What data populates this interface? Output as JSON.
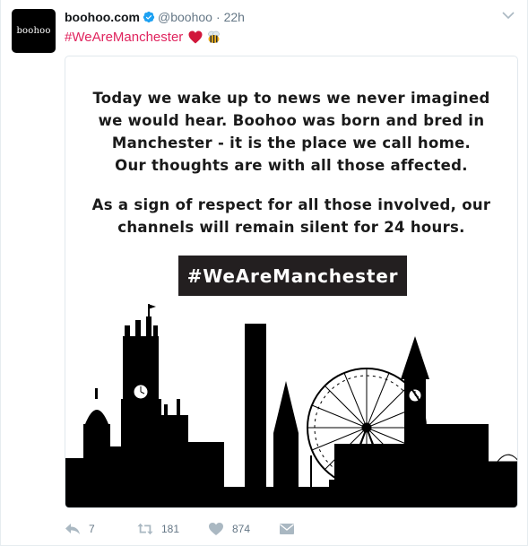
{
  "tweet": {
    "avatar_text": "boohoo",
    "display_name": "boohoo.com",
    "handle": "@boohoo",
    "separator": "·",
    "timestamp": "22h",
    "text": "#WeAreManchester",
    "emoji": [
      "red-heart",
      "bee"
    ]
  },
  "media": {
    "statement_paragraph_1": [
      "Today we wake up to news we never imagined",
      "we would hear.  Boohoo was born and bred in",
      "Manchester - it is the place we call home.",
      "Our thoughts are with all those affected."
    ],
    "statement_paragraph_2": [
      "As a sign of respect for all those involved, our",
      "channels will remain silent for 24 hours."
    ],
    "hashtag_banner": "#WeAreManchester"
  },
  "actions": {
    "reply_count": "7",
    "retweet_count": "181",
    "like_count": "874"
  },
  "colors": {
    "hashtag": "#e0245e",
    "verified": "#1da1f2",
    "muted": "#657786",
    "banner_bg": "#231f20"
  },
  "icons": [
    "verified-badge-icon",
    "caret-down-icon",
    "heart-emoji-icon",
    "bee-emoji-icon",
    "reply-icon",
    "retweet-icon",
    "like-icon",
    "direct-message-icon"
  ]
}
